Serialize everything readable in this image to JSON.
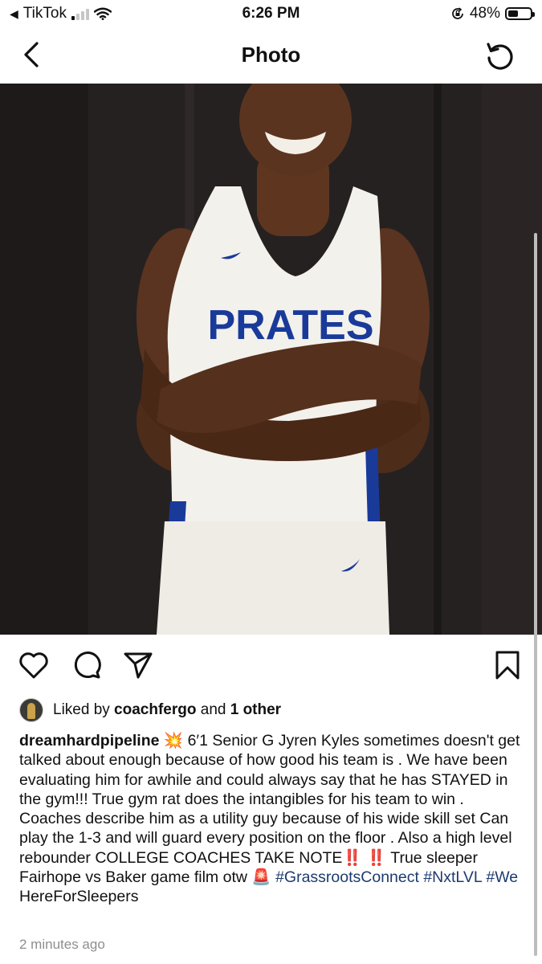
{
  "status_bar": {
    "back_app": "TikTok",
    "back_arrow": "◀",
    "time": "6:26 PM",
    "battery_percent": "48%",
    "battery_level": 0.48,
    "signal_bars_active": 1,
    "icons": [
      "signal-icon",
      "wifi-icon",
      "orientation-lock-icon",
      "battery-icon"
    ]
  },
  "header": {
    "title": "Photo",
    "back_icon": "chevron-left-icon",
    "refresh_icon": "refresh-icon"
  },
  "photo": {
    "jersey_text": "PRATES",
    "description_icon": "photo"
  },
  "actions": {
    "icons": [
      "heart-icon",
      "comment-icon",
      "share-icon",
      "bookmark-icon"
    ]
  },
  "likes": {
    "prefix": "Liked by ",
    "user": "coachfergo",
    "middle": " and ",
    "others": "1 other"
  },
  "caption": {
    "username": "dreamhardpipeline",
    "emoji1": "💥",
    "text1": " 6′1 Senior G Jyren Kyles sometimes doesn't get talked about enough because of how good his team is . We have been evaluating him for awhile and could always say that he has STAYED in the gym!!! True gym rat does the intangibles for his team to win . Coaches describe him as a utility guy because of his wide skill set  Can play the 1-3 and will guard every position on the floor . Also a high level rebounder COLLEGE COACHES TAKE NOTE",
    "emoji2": "‼️ ‼️",
    "text2": " True sleeper Fairhope vs Baker game film otw ",
    "emoji3": "🚨",
    "tag1": "#GrassrootsConnect",
    "tag2": "#NxtLVL",
    "tag3": "#We",
    "text3": " HereForSleepers"
  },
  "time_ago": "2 minutes ago",
  "colors": {
    "hashtag": "#1d3a6e",
    "muted": "#8e8e8e",
    "jersey_blue": "#1a3a9a"
  }
}
